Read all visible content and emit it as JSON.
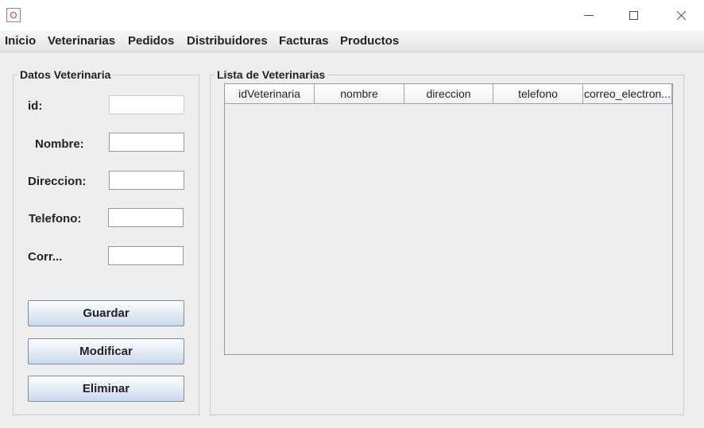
{
  "window": {
    "controls": [
      "minimize",
      "maximize",
      "close"
    ]
  },
  "menu": [
    "Inicio",
    "Veterinarias",
    "Pedidos",
    "Distribuidores",
    "Facturas",
    "Productos"
  ],
  "form": {
    "legend": "Datos Veterinaria",
    "fields": {
      "id": {
        "label": "id:",
        "value": ""
      },
      "nombre": {
        "label": "Nombre:",
        "value": ""
      },
      "direccion": {
        "label": "Direccion:",
        "value": ""
      },
      "telefono": {
        "label": "Telefono:",
        "value": ""
      },
      "correo": {
        "label": "Corr...",
        "value": ""
      }
    },
    "buttons": {
      "save": "Guardar",
      "modify": "Modificar",
      "delete": "Eliminar"
    }
  },
  "list": {
    "legend": "Lista de Veterinarias",
    "columns": [
      "idVeterinaria",
      "nombre",
      "direccion",
      "telefono",
      "correo_electron..."
    ],
    "rows": []
  }
}
